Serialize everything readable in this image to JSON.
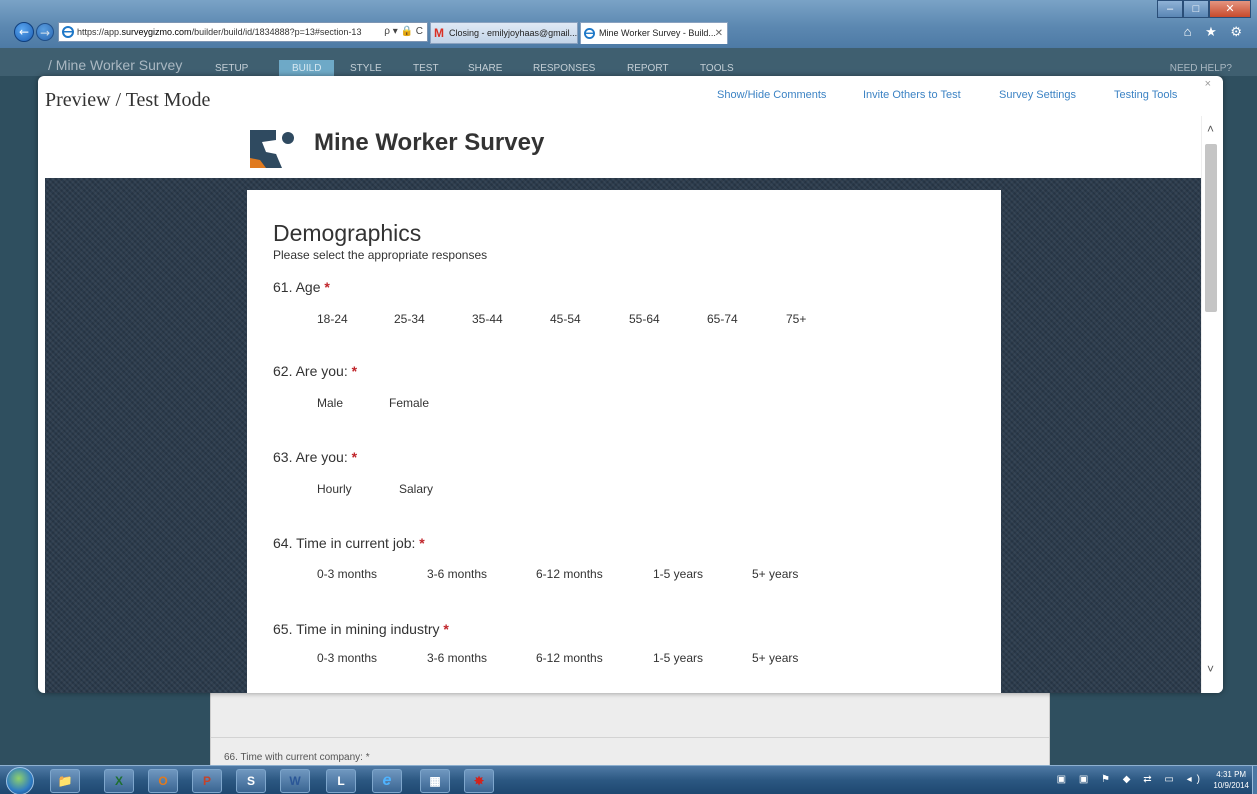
{
  "browser": {
    "url_prefix": "https://app.",
    "url_domain": "surveygizmo.com",
    "url_rest": "/builder/build/id/1834888?p=13#section-13",
    "address_tools": "ρ ▾ 🔒 C",
    "tabs": [
      {
        "label": "Closing - emilyjoyhaas@gmail...",
        "icon": "gmail-icon"
      },
      {
        "label": "Mine Worker Survey - Build...",
        "icon": "ie-icon",
        "close": "✕"
      }
    ],
    "window_controls": {
      "minimize": "–",
      "maximize": "□",
      "close": "✕"
    },
    "toolbar_icons": "⌂ ★ ⚙"
  },
  "app": {
    "breadcrumb": "/ Mine Worker Survey",
    "nav": [
      "SETUP",
      "BUILD",
      "STYLE",
      "TEST",
      "SHARE",
      "RESPONSES",
      "REPORT",
      "TOOLS"
    ],
    "active_nav": "BUILD",
    "need_help": "NEED HELP?"
  },
  "modal": {
    "title": "Preview / Test Mode",
    "links": [
      "Show/Hide Comments",
      "Invite Others to Test",
      "Survey Settings",
      "Testing Tools"
    ],
    "close": "×"
  },
  "survey": {
    "title": "Mine Worker Survey",
    "page_heading": "Demographics",
    "page_description": "Please select the appropriate responses",
    "questions": [
      {
        "title": "61. Age",
        "required": "*",
        "options": [
          "18-24",
          "25-34",
          "35-44",
          "45-54",
          "55-64",
          "65-74",
          "75+"
        ]
      },
      {
        "title": "62. Are you:",
        "required": "*",
        "options": [
          "Male",
          "Female"
        ]
      },
      {
        "title": "63. Are you:",
        "required": "*",
        "options": [
          "Hourly",
          "Salary"
        ]
      },
      {
        "title": "64. Time in current job:",
        "required": "*",
        "options": [
          "0-3 months",
          "3-6 months",
          "6-12 months",
          "1-5 years",
          "5+ years"
        ]
      },
      {
        "title": "65. Time in mining industry",
        "required": "*",
        "options": [
          "0-3 months",
          "3-6 months",
          "6-12 months",
          "1-5 years",
          "5+ years"
        ]
      }
    ]
  },
  "background": {
    "next_question": "66. Time with current company: *"
  },
  "scrollbar": {
    "up": "˄",
    "down": "˅"
  },
  "taskbar": {
    "apps": [
      {
        "icon": "file-explorer-icon",
        "glyph": "📁"
      },
      {
        "icon": "excel-icon",
        "glyph": "X"
      },
      {
        "icon": "outlook-icon",
        "glyph": "O"
      },
      {
        "icon": "powerpoint-icon",
        "glyph": "P"
      },
      {
        "icon": "lync-icon",
        "glyph": "S"
      },
      {
        "icon": "word-icon",
        "glyph": "W"
      },
      {
        "icon": "remote-desktop-icon",
        "glyph": "L"
      },
      {
        "icon": "internet-explorer-icon",
        "glyph": "e"
      },
      {
        "icon": "calculator-icon",
        "glyph": "▦"
      },
      {
        "icon": "acrobat-icon",
        "glyph": "✸"
      }
    ],
    "tray": "▣ ▣ ⚑ ◆ ⇄ ▭ ◂)",
    "time": "4:31 PM",
    "date": "10/9/2014"
  },
  "colors": {
    "link": "#3c83c4",
    "required": "#c0252b",
    "pattern_bg": "#2b3b4c",
    "app_header": "#3f5f70"
  }
}
